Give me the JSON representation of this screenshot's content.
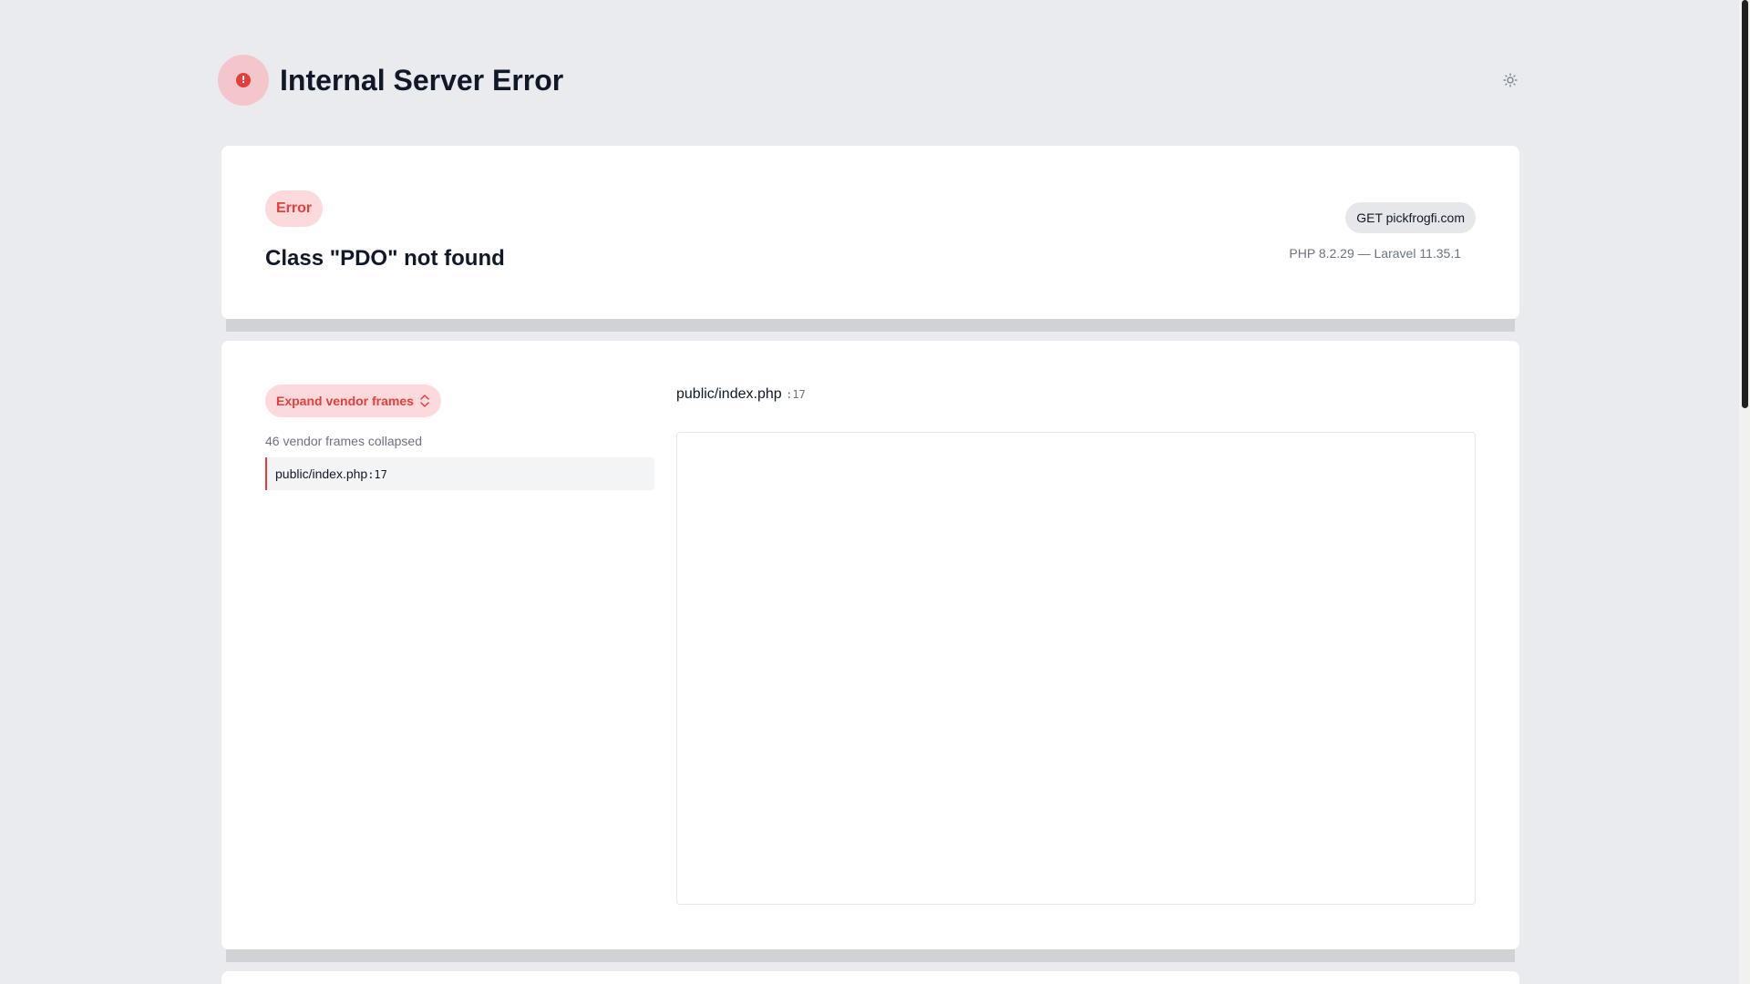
{
  "header": {
    "title": "Internal Server Error",
    "error_icon": "exclamation-icon",
    "theme_icon": "sun-icon"
  },
  "summary": {
    "badge": "Error",
    "message": "Class \"PDO\" not found",
    "request": "GET pickfrogfi.com",
    "versions": "PHP 8.2.29 — Laravel 11.35.1"
  },
  "trace": {
    "expand_label": "Expand vendor frames",
    "expand_icon": "chevron-up-down-icon",
    "collapsed_count": "46 vendor frames collapsed",
    "frames": [
      {
        "file": "public/index.php",
        "line": ":17"
      }
    ],
    "code": {
      "file": "public/index.php",
      "line": ":17"
    }
  },
  "colors": {
    "accent": "#e53e3e",
    "accent_bg": "#fcd9db",
    "page_bg": "#e9ebef"
  }
}
